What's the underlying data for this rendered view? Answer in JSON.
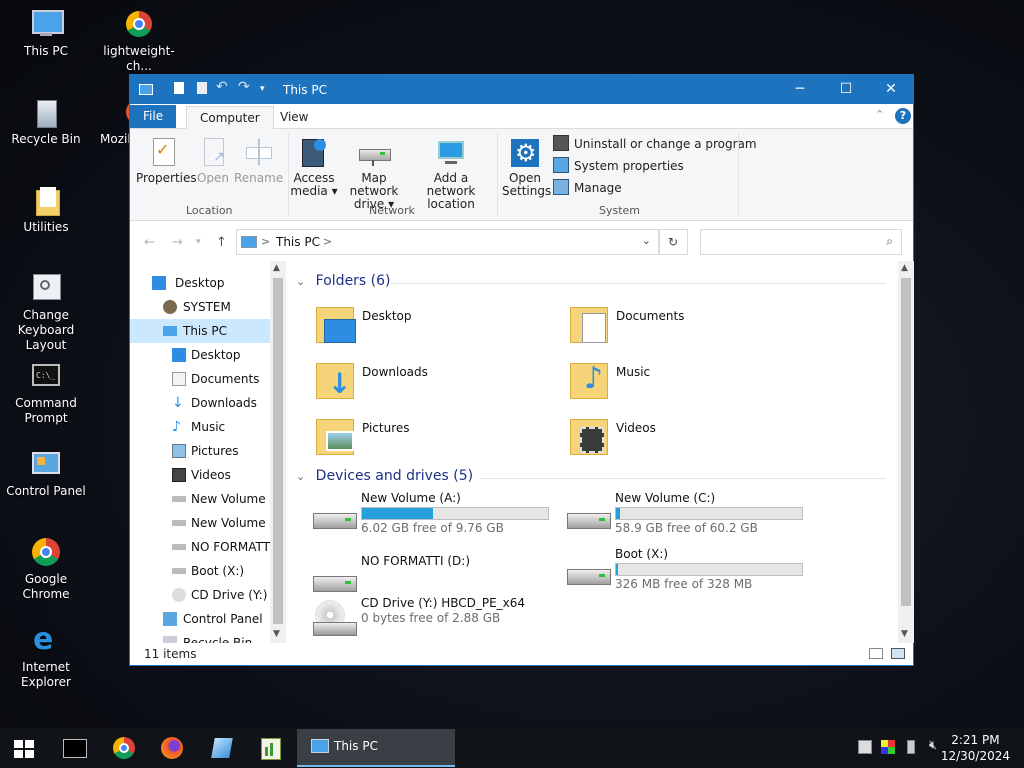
{
  "desktop": {
    "icons": [
      {
        "label": "This PC"
      },
      {
        "label": "lightweight-ch..."
      },
      {
        "label": "Recycle Bin"
      },
      {
        "label": "Mozil"
      },
      {
        "label": "Utilities"
      },
      {
        "label": "Change Keyboard Layout"
      },
      {
        "label": "Command Prompt"
      },
      {
        "label": "Control Panel"
      },
      {
        "label": "Google Chrome"
      },
      {
        "label": "Internet Explorer"
      }
    ]
  },
  "window": {
    "title": "This PC",
    "tabs": {
      "file": "File",
      "computer": "Computer",
      "view": "View"
    },
    "ribbon": {
      "properties": "Properties",
      "open": "Open",
      "rename": "Rename",
      "access_media_1": "Access",
      "access_media_2": "media ▾",
      "map_drive_1": "Map network",
      "map_drive_2": "drive ▾",
      "add_location_1": "Add a network",
      "add_location_2": "location",
      "open_settings_1": "Open",
      "open_settings_2": "Settings",
      "uninstall": "Uninstall or change a program",
      "system_properties": "System properties",
      "manage": "Manage",
      "group_location": "Location",
      "group_network": "Network",
      "group_system": "System"
    },
    "address": {
      "path": "This PC",
      "separator": ">",
      "search_placeholder": ""
    },
    "nav": {
      "items": [
        {
          "label": "Desktop"
        },
        {
          "label": "SYSTEM"
        },
        {
          "label": "This PC"
        },
        {
          "label": "Desktop"
        },
        {
          "label": "Documents"
        },
        {
          "label": "Downloads"
        },
        {
          "label": "Music"
        },
        {
          "label": "Pictures"
        },
        {
          "label": "Videos"
        },
        {
          "label": "New Volume (A"
        },
        {
          "label": "New Volume (C"
        },
        {
          "label": "NO FORMATTI"
        },
        {
          "label": "Boot (X:)"
        },
        {
          "label": "CD Drive (Y:) H"
        },
        {
          "label": "Control Panel"
        },
        {
          "label": "Recycle Bin"
        }
      ]
    },
    "folders_header": "Folders (6)",
    "folders": [
      {
        "label": "Desktop"
      },
      {
        "label": "Documents"
      },
      {
        "label": "Downloads"
      },
      {
        "label": "Music"
      },
      {
        "label": "Pictures"
      },
      {
        "label": "Videos"
      }
    ],
    "drives_header": "Devices and drives (5)",
    "drives": [
      {
        "name": "New Volume (A:)",
        "free": "6.02 GB free of 9.76 GB",
        "used_fraction": 0.38
      },
      {
        "name": "New Volume (C:)",
        "free": "58.9 GB free of 60.2 GB",
        "used_fraction": 0.02
      },
      {
        "name": "NO FORMATTI (D:)",
        "free": "",
        "used_fraction": null
      },
      {
        "name": "Boot (X:)",
        "free": "326 MB free of 328 MB",
        "used_fraction": 0.01
      },
      {
        "name": "CD Drive (Y:) HBCD_PE_x64",
        "free": "0 bytes free of 2.88 GB",
        "used_fraction": null
      }
    ],
    "status": "11 items"
  },
  "taskbar": {
    "active_label": "This PC",
    "time": "2:21 PM",
    "date": "12/30/2024"
  },
  "colors": {
    "accent": "#1e73be",
    "drive_bar": "#26a0da",
    "selection": "#cce8ff"
  }
}
